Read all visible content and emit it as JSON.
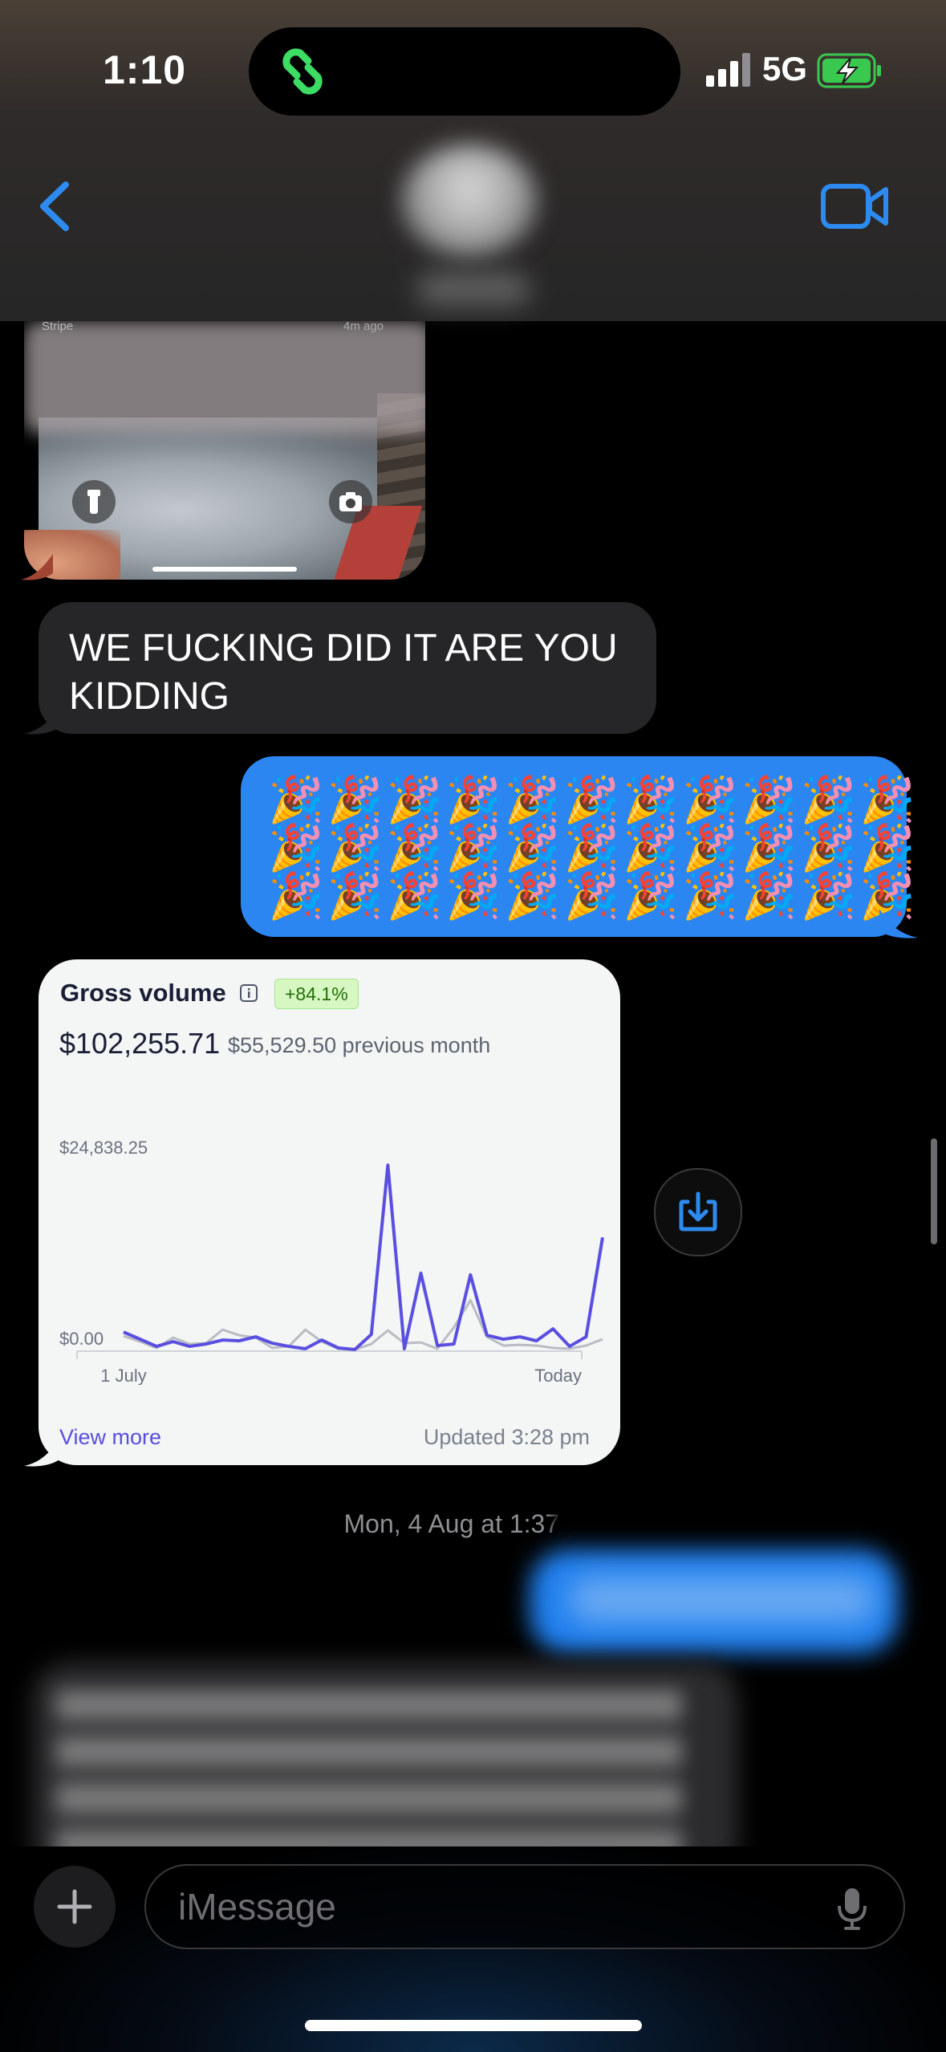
{
  "status_bar": {
    "time": "1:10",
    "network": "5G"
  },
  "header": {
    "contact_name": "",
    "back_icon": "chevron-left-icon",
    "video_icon": "video-camera-icon"
  },
  "image_message": {
    "notif_app": "Stripe",
    "notif_time": "4m ago"
  },
  "messages": {
    "incoming_1": "WE FUCKING DID IT ARE YOU KIDDING",
    "outgoing_party": "🎉🎉🎉🎉🎉🎉🎉🎉🎉🎉🎉\n🎉🎉🎉🎉🎉🎉🎉🎉🎉🎉🎉\n🎉🎉🎉🎉🎉🎉🎉🎉🎉🎉🎉"
  },
  "stripe_card": {
    "title": "Gross volume",
    "change_badge": "+84.1%",
    "amount": "$102,255.71",
    "previous": "$55,529.50 previous month",
    "view_more": "View more",
    "updated": "Updated 3:28 pm",
    "accent_color": "#5a4fe0"
  },
  "chart_data": {
    "type": "line",
    "title": "Gross volume",
    "ytick_top": "$24,838.25",
    "ytick_bottom": "$0.00",
    "ylim": [
      0,
      24838.25
    ],
    "x_start_label": "1 July",
    "x_end_label": "Today",
    "series": [
      {
        "color": "#5a4fe0",
        "values": [
          2400,
          1500,
          600,
          1200,
          600,
          900,
          1400,
          1300,
          1800,
          1000,
          600,
          300,
          1400,
          400,
          200,
          2100,
          23400,
          300,
          9800,
          700,
          900,
          9600,
          2000,
          1500,
          1800,
          1300,
          2800,
          600,
          1800,
          14300
        ]
      },
      {
        "color": "#b9bcc2",
        "values": [
          1900,
          1200,
          400,
          1700,
          900,
          1000,
          2700,
          2000,
          1700,
          400,
          600,
          2700,
          1200,
          300,
          200,
          900,
          2600,
          1000,
          1100,
          300,
          3000,
          6400,
          1800,
          700,
          800,
          700,
          400,
          300,
          700,
          1500
        ]
      }
    ]
  },
  "timestamp": "Mon, 4 Aug at 1:37 pm",
  "input": {
    "placeholder": "iMessage"
  }
}
